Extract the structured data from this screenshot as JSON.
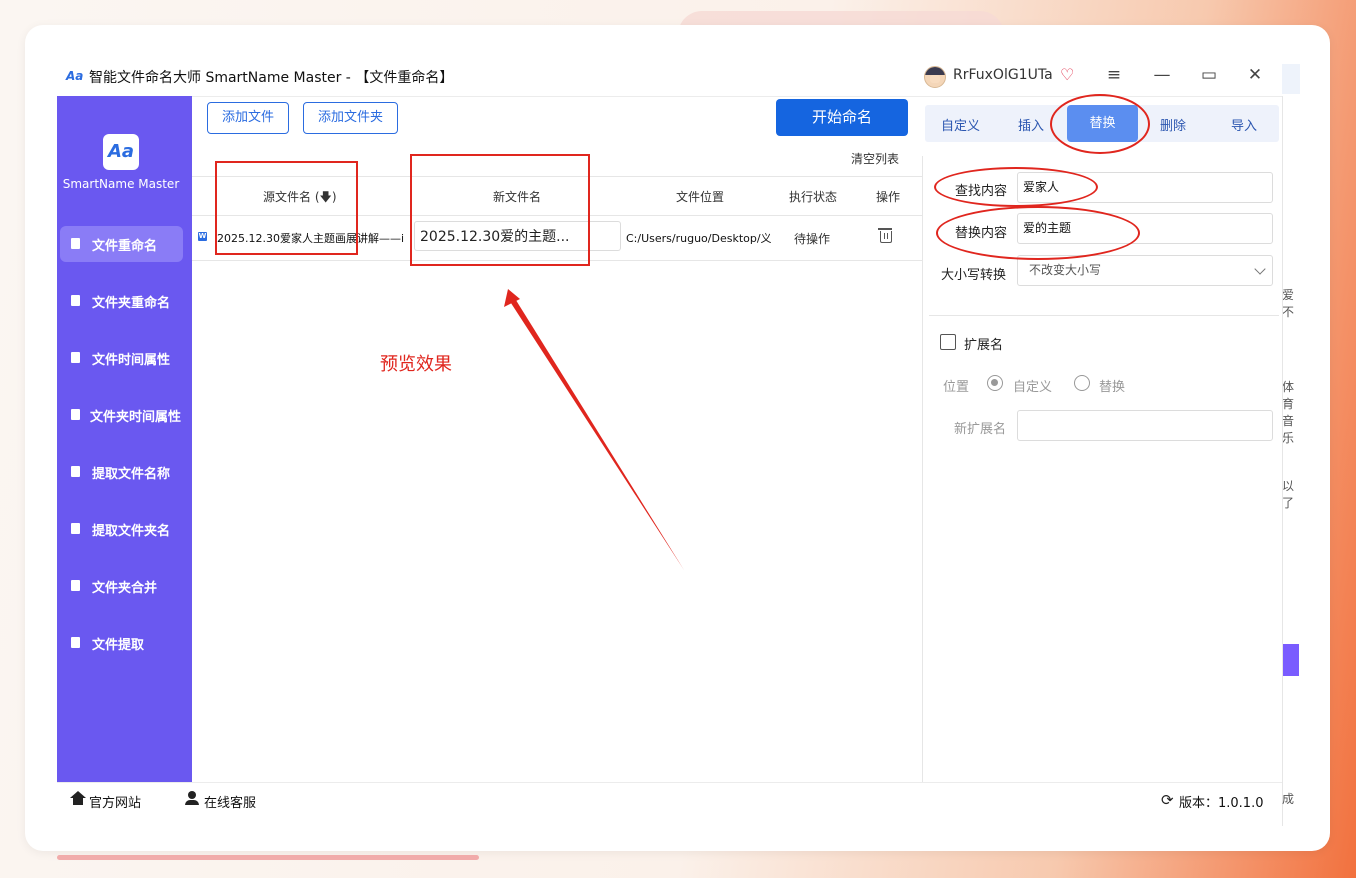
{
  "window": {
    "title": "智能文件命名大师 SmartName Master - 【文件重命名】",
    "username": "RrFuxOlG1UTa",
    "logo_glyph": "Aa"
  },
  "sidebar": {
    "app_name": "SmartName Master",
    "items": [
      {
        "label": "文件重命名",
        "active": true
      },
      {
        "label": "文件夹重命名"
      },
      {
        "label": "文件时间属性"
      },
      {
        "label": "文件夹时间属性"
      },
      {
        "label": "提取文件名称"
      },
      {
        "label": "提取文件夹名"
      },
      {
        "label": "文件夹合并"
      },
      {
        "label": "文件提取"
      }
    ]
  },
  "toolbar": {
    "add_file": "添加文件",
    "add_folder": "添加文件夹",
    "start": "开始命名",
    "clear_list": "清空列表"
  },
  "table": {
    "headers": [
      "源文件名 (🡇)",
      "新文件名",
      "文件位置",
      "执行状态",
      "操作"
    ],
    "rows": [
      {
        "source": "2025.12.30爱家人主题画展讲解——i",
        "new_name": "2025.12.30爱的主题...",
        "path": "C:/Users/ruguo/Desktop/义",
        "status": "待操作"
      }
    ]
  },
  "panel": {
    "tabs": [
      "自定义",
      "插入",
      "替换",
      "删除",
      "导入"
    ],
    "active_tab": "替换",
    "find_label": "查找内容",
    "find_value": "爱家人",
    "replace_label": "替换内容",
    "replace_value": "爱的主题",
    "case_label": "大小写转换",
    "case_value": "不改变大小写",
    "ext_label": "扩展名",
    "pos_label": "位置",
    "opt_custom": "自定义",
    "opt_replace": "替换",
    "new_ext_label": "新扩展名",
    "new_ext_value": ""
  },
  "footer": {
    "website": "官方网站",
    "support": "在线客服",
    "version": "版本：1.0.1.0"
  },
  "annotation": {
    "preview_label": "预览效果",
    "color": "#e0261e"
  },
  "bg_partial": [
    "爱不",
    "体育",
    "音乐",
    "以了",
    "成"
  ]
}
